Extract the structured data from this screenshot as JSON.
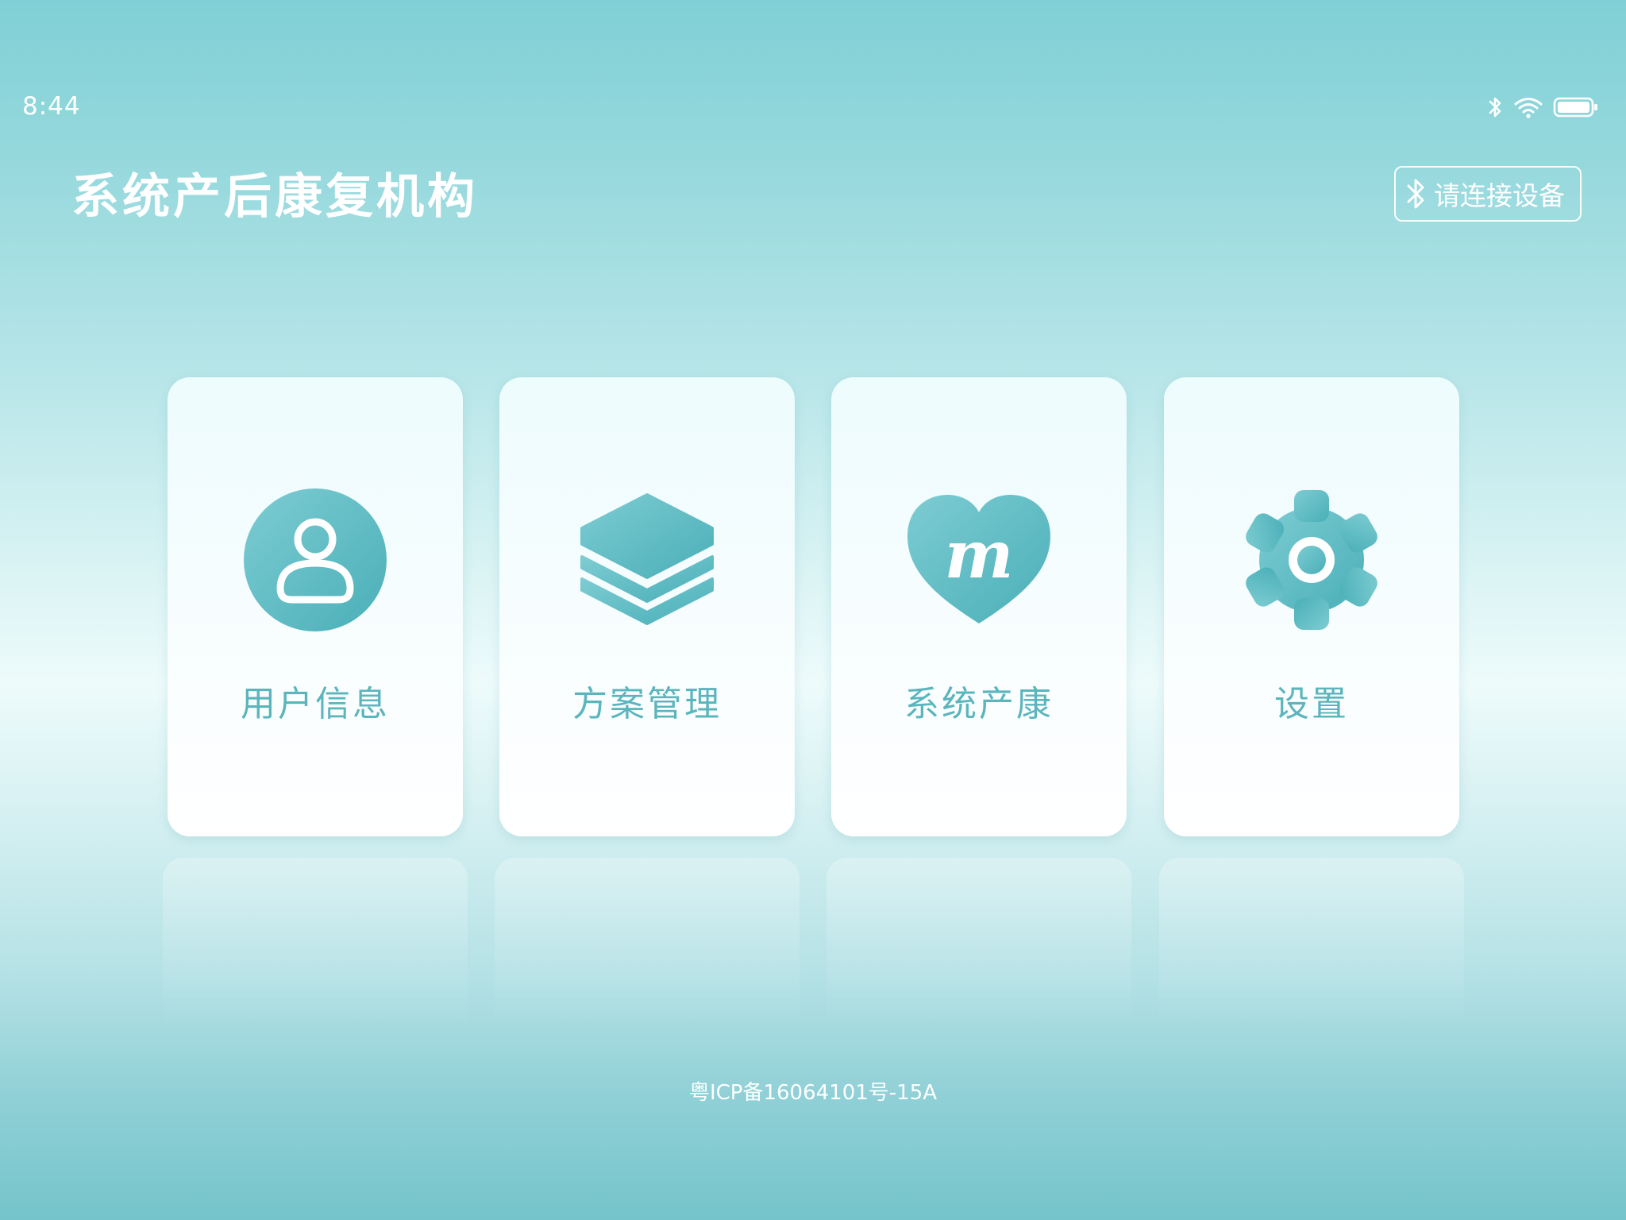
{
  "status_bar": {
    "time": "8:44",
    "icons": [
      "bluetooth-icon",
      "wifi-icon",
      "battery-icon"
    ],
    "battery_level": 1.0
  },
  "header": {
    "title": "系统产后康复机构",
    "connect_button": {
      "label": "请连接设备",
      "icon": "bluetooth-icon"
    }
  },
  "menu": {
    "items": [
      {
        "label": "用户信息",
        "icon": "user-icon"
      },
      {
        "label": "方案管理",
        "icon": "layers-icon"
      },
      {
        "label": "系统产康",
        "icon": "heart-m-icon"
      },
      {
        "label": "设置",
        "icon": "gear-icon"
      }
    ]
  },
  "footer": {
    "icp": "粤ICP备16064101号-15A"
  },
  "colors": {
    "accent": "#5bb5bd",
    "icon_gradient_start": "#7dccd2",
    "icon_gradient_end": "#4aafb8",
    "background_top": "#7fd0d6",
    "card_background": "#ffffff"
  }
}
